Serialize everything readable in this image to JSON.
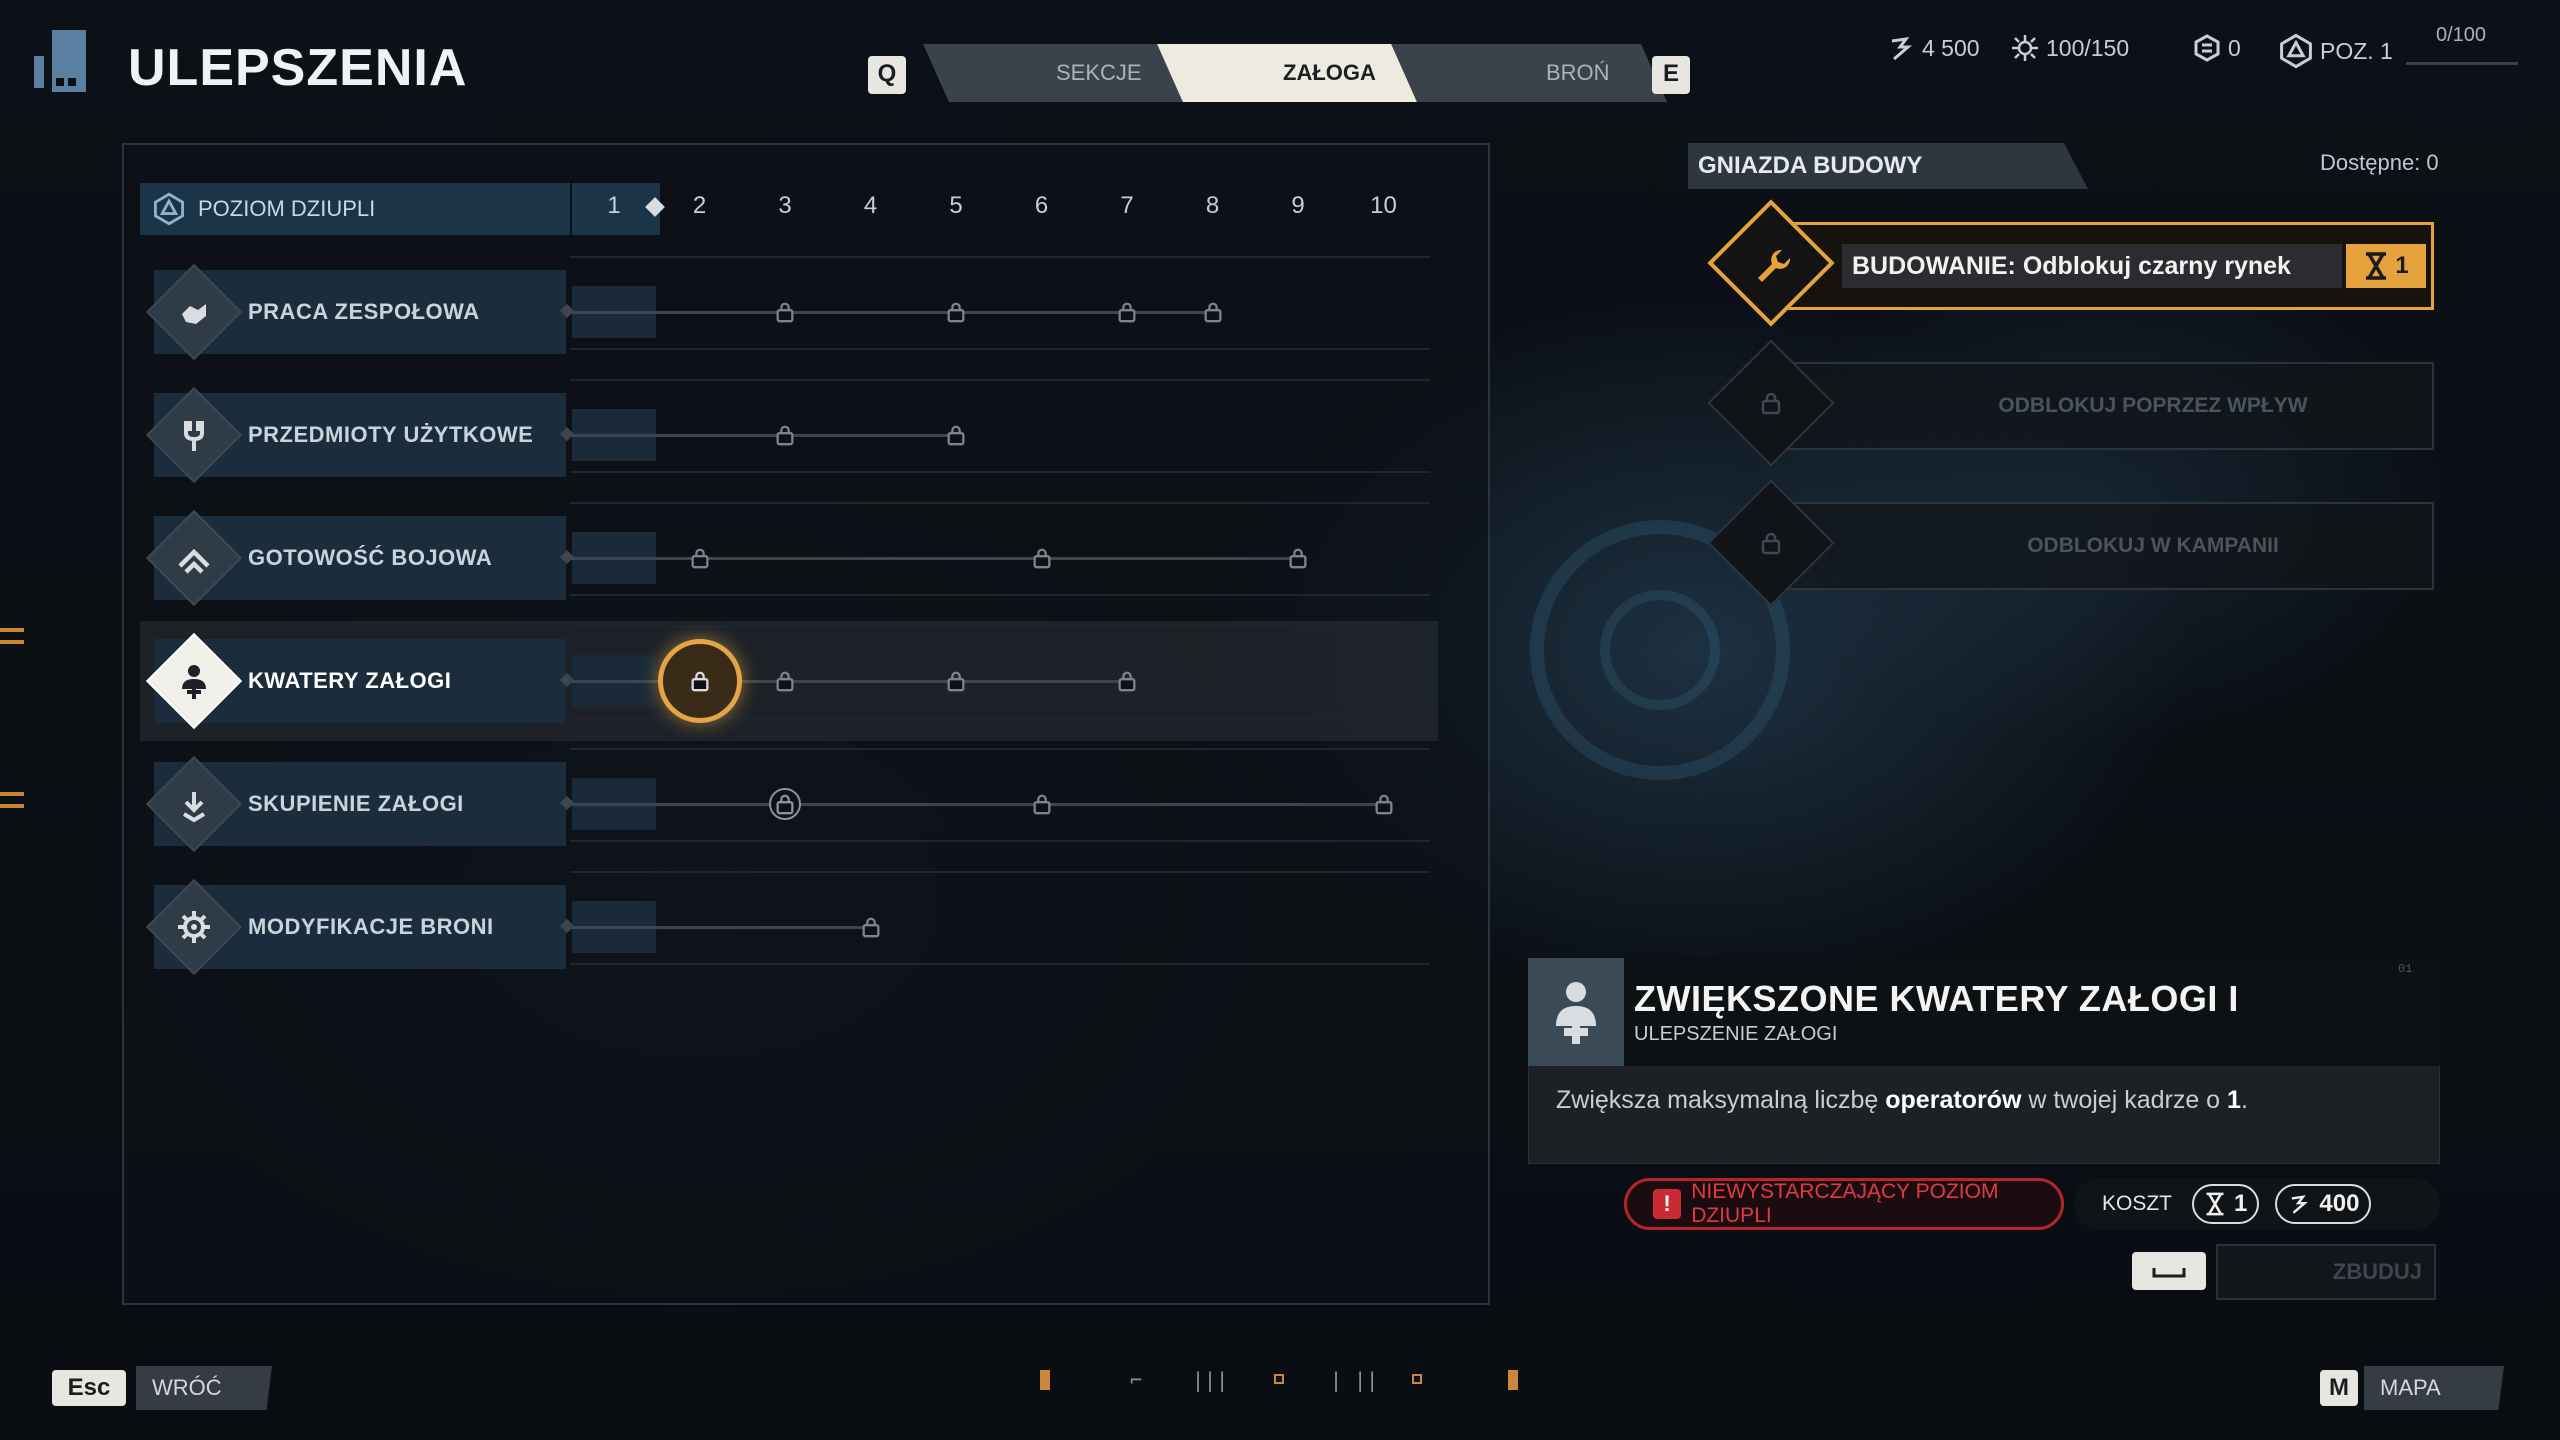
{
  "header": {
    "title": "ULEPSZENIA",
    "tab_prev_key": "Q",
    "tab_next_key": "E",
    "tabs": [
      {
        "label": "SEKCJE",
        "active": false
      },
      {
        "label": "ZAŁOGA",
        "active": true
      },
      {
        "label": "BROŃ",
        "active": false
      }
    ]
  },
  "resources": {
    "currency": "4 500",
    "energy": "100/150",
    "tokens": "0",
    "level": "POZ. 1",
    "xp": "0/100",
    "xp_progress": 0
  },
  "level_grid": {
    "label": "POZIOM DZIUPLI",
    "current_level": 1,
    "levels": [
      "1",
      "2",
      "3",
      "4",
      "5",
      "6",
      "7",
      "8",
      "9",
      "10"
    ]
  },
  "rows": [
    {
      "label": "PRACA ZESPOŁOWA",
      "icon": "hand-shake-icon",
      "locks": [
        3,
        5,
        7,
        8
      ],
      "selected": false
    },
    {
      "label": "PRZEDMIOTY UŻYTKOWE",
      "icon": "tool-fork-icon",
      "locks": [
        3,
        5
      ],
      "selected": false
    },
    {
      "label": "GOTOWOŚĆ BOJOWA",
      "icon": "chevron-up-icon",
      "locks": [
        2,
        6,
        9
      ],
      "selected": false
    },
    {
      "label": "KWATERY ZAŁOGI",
      "icon": "crew-medic-icon",
      "locks": [
        2,
        3,
        5,
        7
      ],
      "selected": true
    },
    {
      "label": "SKUPIENIE ZAŁOGI",
      "icon": "focus-arrow-icon",
      "locks": [
        3,
        6,
        10
      ],
      "selected": false
    },
    {
      "label": "MODYFIKACJE BRONI",
      "icon": "gear-icon",
      "locks": [
        4
      ],
      "selected": false
    }
  ],
  "build_slots": {
    "header": "GNIAZDA BUDOWY",
    "available": "Dostępne: 0",
    "active_slot": {
      "label": "BUDOWANIE: Odblokuj czarny rynek",
      "badge": "1"
    },
    "locked_slots": [
      "ODBLOKUJ POPRZEZ WPŁYW",
      "ODBLOKUJ W KAMPANII"
    ]
  },
  "detail": {
    "corner_tag": "01",
    "title": "ZWIĘKSZONE KWATERY ZAŁOGI I",
    "subtitle": "ULEPSZENIE ZAŁOGI",
    "desc_pre": "Zwiększa maksymalną liczbę ",
    "desc_bold1": "operatorów",
    "desc_mid": " w twojej kadrze o ",
    "desc_bold2": "1",
    "desc_post": ".",
    "warning": "NIEWYSTARCZAJĄCY POZIOM DZIUPLI",
    "warning_mark": "!",
    "cost_label": "KOSZT",
    "cost_time": "1",
    "cost_currency": "400",
    "build_label": "ZBUDUJ",
    "build_key": "space"
  },
  "footer": {
    "back_key": "Esc",
    "back_label": "WRÓĆ",
    "map_key": "M",
    "map_label": "MAPA"
  },
  "colors": {
    "accent": "#e6a23c",
    "warning": "#c92a33",
    "label_bg": "#1b2d3c"
  }
}
